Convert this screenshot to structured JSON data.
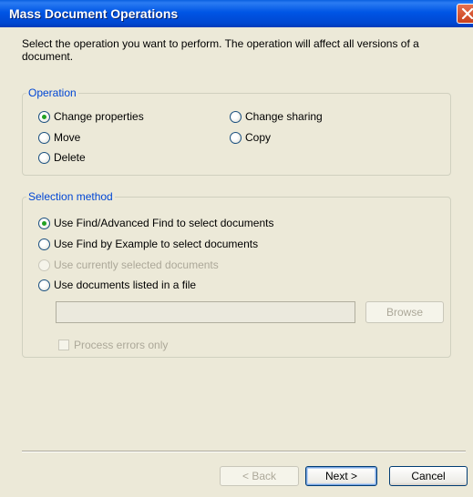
{
  "dialog": {
    "title": "Mass Document Operations"
  },
  "intro_text": "Select the operation you want to perform. The operation will affect all versions of a document.",
  "operation": {
    "legend": "Operation",
    "options": [
      {
        "label": "Change properties",
        "checked": true
      },
      {
        "label": "Change sharing",
        "checked": false
      },
      {
        "label": "Move",
        "checked": false
      },
      {
        "label": "Copy",
        "checked": false
      },
      {
        "label": "Delete",
        "checked": false
      }
    ]
  },
  "selection": {
    "legend": "Selection method",
    "options": [
      {
        "label": "Use Find/Advanced Find to select documents",
        "checked": true,
        "enabled": true
      },
      {
        "label": "Use Find by Example to select documents",
        "checked": false,
        "enabled": true
      },
      {
        "label": "Use currently selected documents",
        "checked": false,
        "enabled": false
      },
      {
        "label": "Use documents listed in a file",
        "checked": false,
        "enabled": true
      }
    ],
    "file_path_value": "",
    "browse_label": "Browse",
    "process_errors_label": "Process errors only",
    "process_errors_checked": false
  },
  "footer": {
    "back_label": "< Back",
    "next_label": "Next >",
    "cancel_label": "Cancel"
  },
  "colors": {
    "title_bar": "#0055e5",
    "legend_text": "#0046d5",
    "radio_dot": "#21a121",
    "close_button": "#c8401d"
  }
}
